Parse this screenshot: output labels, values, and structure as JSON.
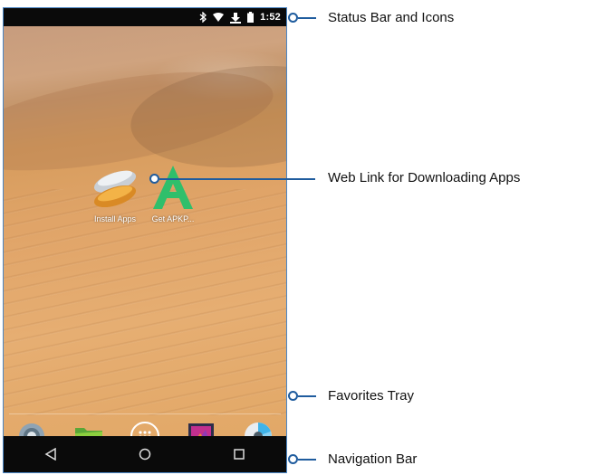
{
  "status_bar": {
    "time": "1:52",
    "icons": [
      "bluetooth-icon",
      "wifi-icon",
      "download-icon",
      "battery-icon"
    ]
  },
  "home_screen": {
    "apps": [
      {
        "label": "Install Apps",
        "icon": "install-apps-icon"
      },
      {
        "label": "Get APKP...",
        "icon": "apk-store-icon"
      }
    ],
    "favorites": [
      "settings-icon",
      "files-icon",
      "app-drawer-icon",
      "gallery-icon",
      "camera-icon"
    ]
  },
  "nav_bar": {
    "buttons": [
      "back-icon",
      "home-icon",
      "recents-icon"
    ]
  },
  "callouts": {
    "status": "Status Bar and Icons",
    "weblink": "Web Link for Downloading Apps",
    "favorites": "Favorites Tray",
    "navigation": "Navigation Bar"
  },
  "colors": {
    "callout": "#1f5c9e",
    "frame": "#4a86c5",
    "apk_green": "#2fbf6b"
  }
}
